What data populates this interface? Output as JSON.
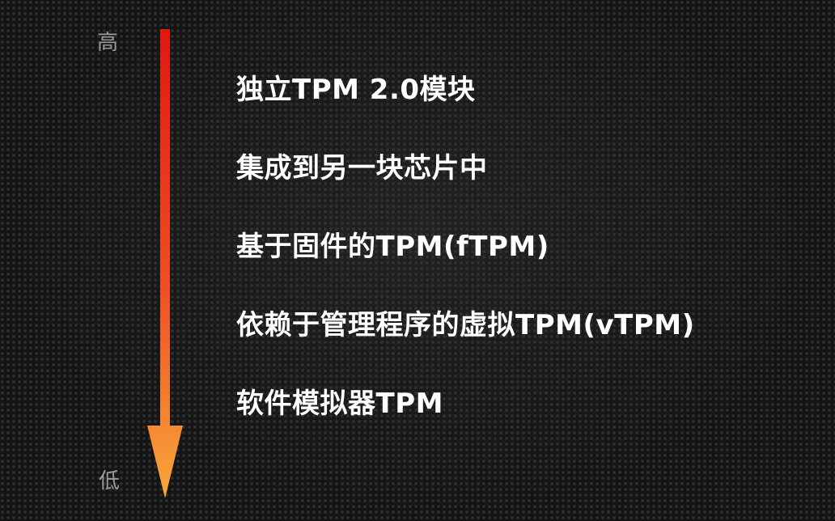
{
  "scale": {
    "high_label": "高",
    "low_label": "低",
    "arrow_colors": {
      "top": "#e2180f",
      "middle": "#ee4f25",
      "bottom": "#f7a83a"
    }
  },
  "levels": [
    "独立TPM 2.0模块",
    "集成到另一块芯片中",
    "基于固件的TPM(fTPM)",
    "依赖于管理程序的虚拟TPM(vTPM)",
    "软件模拟器TPM"
  ]
}
